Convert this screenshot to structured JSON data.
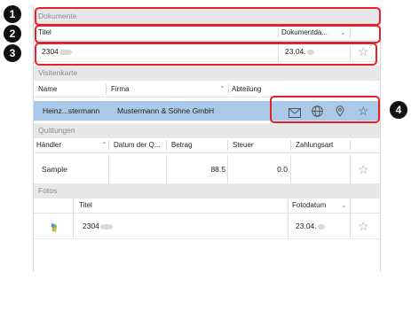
{
  "dokumente": {
    "header": "Dokumente",
    "columns": {
      "titel": "Titel",
      "dokumentdatum": "Dokumentda..."
    },
    "row": {
      "titel": "2304",
      "datum": "23.04."
    }
  },
  "visitenkarte": {
    "header": "Visitenkarte",
    "columns": {
      "name": "Name",
      "firma": "Firma",
      "abteilung": "Abteilung"
    },
    "row": {
      "name": "Heinz...stermann",
      "firma": "Mustermann & Söhne GmbH"
    }
  },
  "quittungen": {
    "header": "Quittungen",
    "columns": {
      "haendler": "Händler",
      "datum": "Datum der Q...",
      "betrag": "Betrag",
      "steuer": "Steuer",
      "zahlungsart": "Zahlungsart"
    },
    "row": {
      "haendler": "Sample",
      "betrag": "88.5",
      "steuer": "0.0"
    }
  },
  "fotos": {
    "header": "Fotos",
    "columns": {
      "titel": "Titel",
      "fotodatum": "Fotodatum"
    },
    "row": {
      "titel": "2304",
      "datum": "23.04."
    }
  },
  "callouts": [
    "1",
    "2",
    "3",
    "4"
  ],
  "icons": {
    "sort": "chevron-down-icon",
    "sort_up": "chevron-up-icon",
    "favorite": "star-icon",
    "mail": "mail-icon",
    "web": "globe-icon",
    "location": "map-pin-icon",
    "photo": "photo-thumbnail-icon"
  },
  "colors": {
    "callout": "#e8202a",
    "selection": "#aac9e8",
    "section_header": "#e8e8e8"
  }
}
